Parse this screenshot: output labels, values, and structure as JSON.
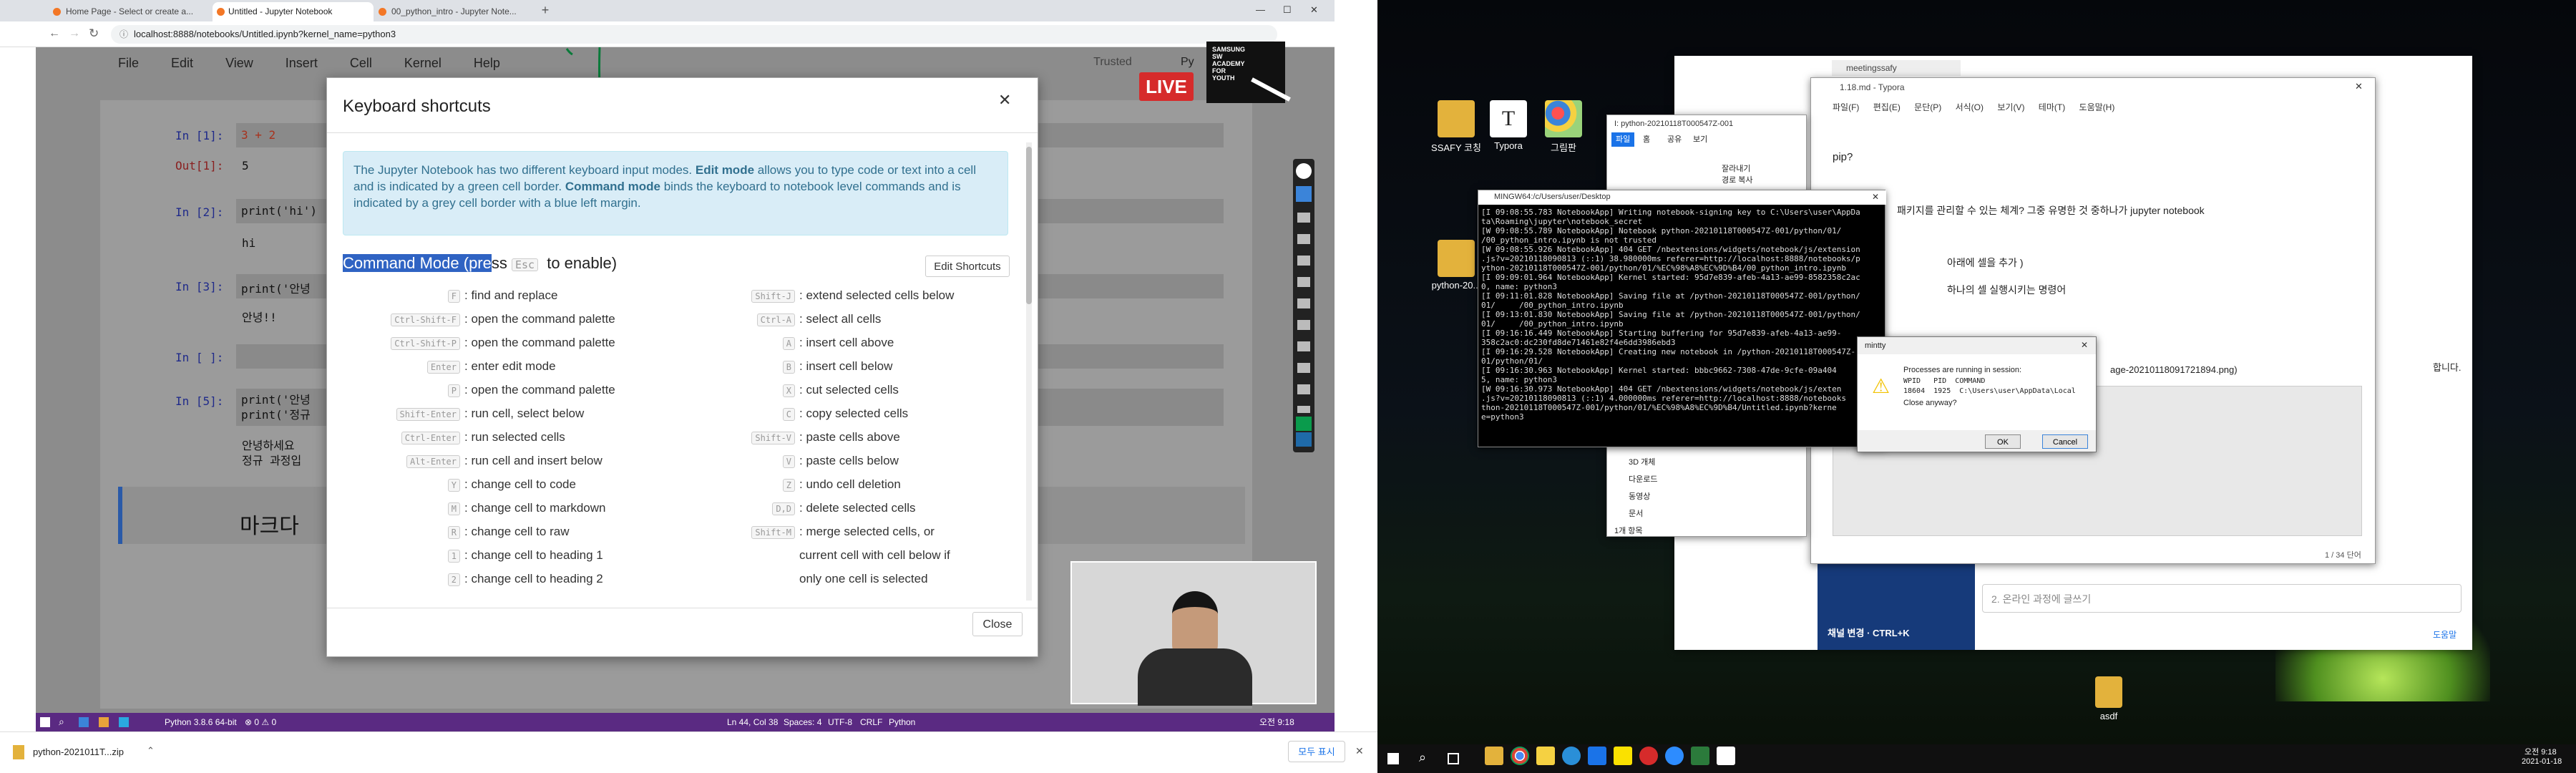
{
  "browser": {
    "tabs": [
      {
        "label": "Home Page - Select or create a..."
      },
      {
        "label": "Untitled - Jupyter Notebook"
      },
      {
        "label": "00_python_intro - Jupyter Note..."
      }
    ],
    "new_tab": "+",
    "url": "localhost:8888/notebooks/Untitled.ipynb?kernel_name=python3"
  },
  "jupyter": {
    "menu": [
      "File",
      "Edit",
      "View",
      "Insert",
      "Cell",
      "Kernel",
      "Help"
    ],
    "trusted": "Trusted",
    "kernel_short": "Py",
    "cells": [
      {
        "prompt": "In [1]:",
        "code": "3 + 2"
      },
      {
        "prompt": "Out[1]:",
        "output": "5"
      },
      {
        "prompt": "In [2]:",
        "code": "print('hi')"
      },
      {
        "prompt": "",
        "output": "hi"
      },
      {
        "prompt": "In [3]:",
        "code": "print('안녕"
      },
      {
        "prompt": "",
        "output": "안녕!!"
      },
      {
        "prompt": "In [ ]:",
        "code": ""
      },
      {
        "prompt": "In [5]:",
        "code": "print('안녕\nprint('정규"
      },
      {
        "prompt": "",
        "output": "안녕하세요\n정규 과정입"
      },
      {
        "prompt": "",
        "markdown": "마크다"
      }
    ]
  },
  "live": {
    "badge": "LIVE",
    "logo": "SAMSUNG\nSW\nACADEMY\nFOR\nYOUTH"
  },
  "modal": {
    "title": "Keyboard shortcuts",
    "info_1": "The Jupyter Notebook has two different keyboard input modes. ",
    "info_edit": "Edit mode",
    "info_2": " allows you to type code or text into a cell and is indicated by a green cell border. ",
    "info_cmd": "Command mode",
    "info_3": " binds the keyboard to notebook level commands and is indicated by a grey cell border with a blue left margin.",
    "mode_title_a": "Command Mode (pre",
    "mode_title_b": "ss ",
    "mode_key": "Esc",
    "mode_title_c": " to enable)",
    "edit_shortcuts": "Edit Shortcuts",
    "close": "Close",
    "left": [
      {
        "key": "F",
        "desc": ": find and replace"
      },
      {
        "key": "Ctrl-Shift-F",
        "desc": ": open the command palette"
      },
      {
        "key": "Ctrl-Shift-P",
        "desc": ": open the command palette"
      },
      {
        "key": "Enter",
        "desc": ": enter edit mode"
      },
      {
        "key": "P",
        "desc": ": open the command palette"
      },
      {
        "key": "Shift-Enter",
        "desc": ": run cell, select below"
      },
      {
        "key": "Ctrl-Enter",
        "desc": ": run selected cells"
      },
      {
        "key": "Alt-Enter",
        "desc": ": run cell and insert below"
      },
      {
        "key": "Y",
        "desc": ": change cell to code"
      },
      {
        "key": "M",
        "desc": ": change cell to markdown"
      },
      {
        "key": "R",
        "desc": ": change cell to raw"
      },
      {
        "key": "1",
        "desc": ": change cell to heading 1"
      },
      {
        "key": "2",
        "desc": ": change cell to heading 2"
      }
    ],
    "right": [
      {
        "key": "Shift-J",
        "desc": ": extend selected cells below"
      },
      {
        "key": "Ctrl-A",
        "desc": ": select all cells"
      },
      {
        "key": "A",
        "desc": ": insert cell above"
      },
      {
        "key": "B",
        "desc": ": insert cell below"
      },
      {
        "key": "X",
        "desc": ": cut selected cells"
      },
      {
        "key": "C",
        "desc": ": copy selected cells"
      },
      {
        "key": "Shift-V",
        "desc": ": paste cells above"
      },
      {
        "key": "V",
        "desc": ": paste cells below"
      },
      {
        "key": "Z",
        "desc": ": undo cell deletion"
      },
      {
        "key": "D,D",
        "desc": ": delete selected cells"
      },
      {
        "key": "Shift-M",
        "desc": ": merge selected cells, or"
      },
      {
        "key": "",
        "desc": "current cell with cell below if"
      },
      {
        "key": "",
        "desc": "only one cell is selected"
      }
    ]
  },
  "vscode_status": {
    "python": "Python 3.8.6 64-bit",
    "problems": "⊗ 0 ⚠ 0",
    "pos": "Ln 44, Col 38",
    "spaces": "Spaces: 4",
    "enc": "UTF-8",
    "eol": "CRLF",
    "lang": "Python",
    "clock": "오전 9:18"
  },
  "download_bar": {
    "file": "python-2021011T...zip",
    "show_all": "모두 표시"
  },
  "desktop_icons": [
    {
      "label": "SSAFY 코칭"
    },
    {
      "label": "Typora"
    },
    {
      "label": "그림판"
    },
    {
      "label": "python-20..."
    },
    {
      "label": "asdf"
    }
  ],
  "typora": {
    "title": "1.18.md - Typora",
    "menu": [
      "파일(F)",
      "편집(E)",
      "문단(P)",
      "서식(O)",
      "보기(V)",
      "테마(T)",
      "도움말(H)"
    ],
    "lines": [
      "pip?",
      "패키지를 관리할 수 있는 체계? 그중 유명한 것 중하나가 jupyter notebook",
      "아래에 셀을 추가 )",
      "하나의 셀 실행시키는 명령어",
      "age-20210118091721894.png)"
    ],
    "word_count": "1 / 34 단어"
  },
  "meeting": {
    "tab": "meetingssafy",
    "channel": "채널 변경 · CTRL+K",
    "input": "2. 온라인 과정에 글쓰기",
    "help": "도움말",
    "tail": "합니다."
  },
  "explorer": {
    "title": "I: python-20210118T000547Z-001",
    "tabs": [
      "파일",
      "홈",
      "공유",
      "보기"
    ],
    "ribbon": [
      "잘라내기",
      "경로 복사"
    ],
    "items": [
      "3D 개체",
      "다운로드",
      "동영상",
      "문서"
    ],
    "count": "1개 항목"
  },
  "terminal": {
    "title": "MINGW64:/c/Users/user/Desktop",
    "lines": [
      "[I 09:08:55.783 NotebookApp] Writing notebook-signing key to C:\\Users\\user\\AppDa",
      "ta\\Roaming\\jupyter\\notebook_secret",
      "[W 09:08:55.789 NotebookApp] Notebook python-20210118T000547Z-001/python/01/",
      "/00_python_intro.ipynb is not trusted",
      "[W 09:08:55.926 NotebookApp] 404 GET /nbextensions/widgets/notebook/js/extension",
      ".js?v=20210118090813 (::1) 38.980000ms referer=http://localhost:8888/notebooks/p",
      "ython-20210118T000547Z-001/python/01/%EC%98%A8%EC%9D%B4/00_python_intro.ipynb",
      "[I 09:09:01.964 NotebookApp] Kernel started: 95d7e839-afeb-4a13-ae99-8582358c2ac",
      "0, name: python3",
      "[I 09:11:01.828 NotebookApp] Saving file at /python-20210118T000547Z-001/python/",
      "01/     /00_python_intro.ipynb",
      "[I 09:13:01.830 NotebookApp] Saving file at /python-20210118T000547Z-001/python/",
      "01/     /00_python_intro.ipynb",
      "[I 09:16:16.449 NotebookApp] Starting buffering for 95d7e839-afeb-4a13-ae99-",
      "358c2ac0:dc230fd8de71461e82f4e6dd3986ebd3",
      "[I 09:16:29.528 NotebookApp] Creating new notebook in /python-20210118T000547Z-",
      "01/python/01/",
      "[I 09:16:30.963 NotebookApp] Kernel started: bbbc9662-7308-47de-9cfe-09a404",
      "5, name: python3",
      "[W 09:16:30.973 NotebookApp] 404 GET /nbextensions/widgets/notebook/js/exten",
      ".js?v=20210118090813 (::1) 4.000000ms referer=http://localhost:8888/notebooks",
      "thon-20210118T000547Z-001/python/01/%EC%98%A8%EC%9D%B4/Untitled.ipynb?kerne",
      "e=python3"
    ]
  },
  "mintty": {
    "title": "mintty",
    "msg1": "Processes are running in session:",
    "head": "WPID   PID  COMMAND",
    "row": "18604  1925  C:\\Users\\user\\AppData\\Local",
    "msg2": "Close anyway?",
    "ok": "OK",
    "cancel": "Cancel"
  },
  "taskbar_right": {
    "time": "오전 9:18",
    "date": "2021-01-18"
  }
}
